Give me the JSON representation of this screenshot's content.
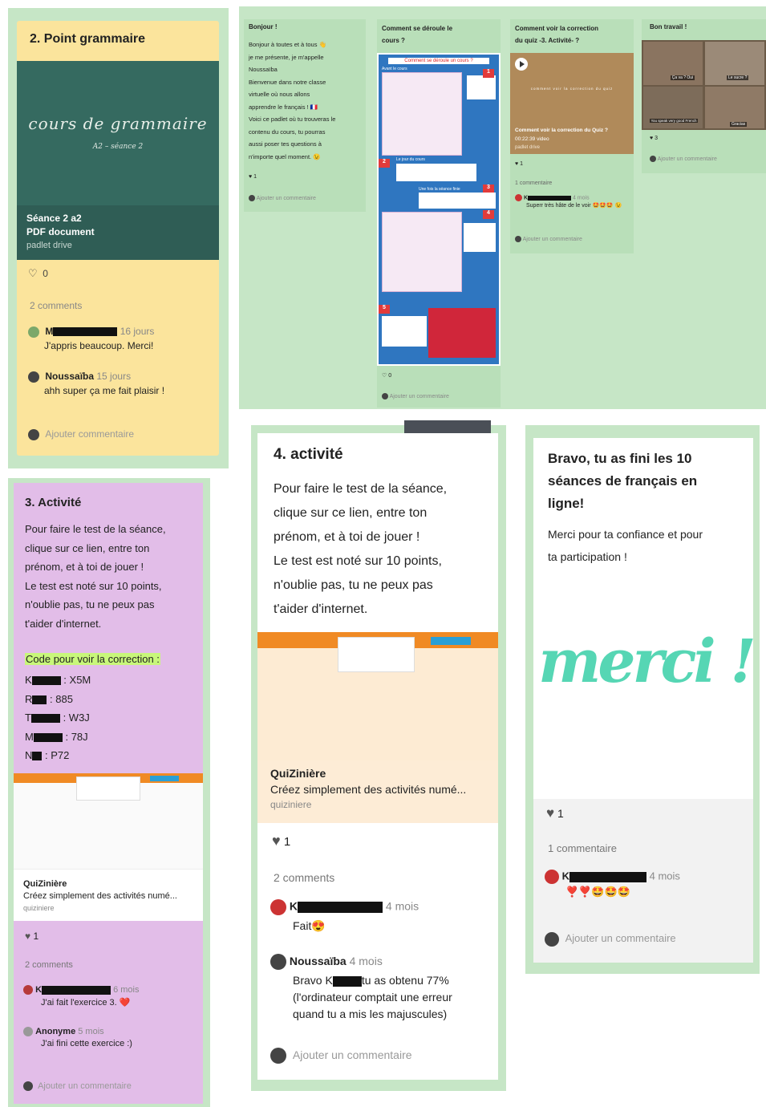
{
  "colors": {
    "board_bg": "#c6e6c6",
    "card_yellow": "#fbe49c",
    "card_purple": "#e2bde8",
    "chalkboard": "#2f5d55",
    "quiz_orange": "#f08a24",
    "white": "#ffffff"
  },
  "card_grammar": {
    "title": "2. Point grammaire",
    "chalk_title": "cours de grammaire",
    "chalk_sub": "A2 – séance 2",
    "attach_title": "Séance 2 a2",
    "attach_type": "PDF document",
    "attach_source": "padlet drive",
    "likes": "0",
    "comment_count": "2 comments",
    "comments": [
      {
        "name": "M",
        "time": "16 jours",
        "text": "J'appris beaucoup. Merci!"
      },
      {
        "name": "Noussaïba",
        "time": "15 jours",
        "text": "ahh super ça me fait plaisir !"
      }
    ],
    "add_comment": "Ajouter commentaire",
    "icons": [
      "heart-icon",
      "avatar-icon"
    ]
  },
  "strip": {
    "col1": {
      "title": "Bonjour !",
      "lines": [
        "Bonjour à toutes et à tous 👋",
        "je me présente, je m'appelle",
        "Noussaïba",
        "Bienvenue dans notre classe",
        "virtuelle où nous allons",
        "apprendre le français ! 🇫🇷",
        "Voici ce padlet où tu trouveras le",
        "contenu du cours, tu pourras",
        "aussi poser tes questions à",
        "n'importe quel moment. 😉"
      ],
      "likes": "1",
      "add_comment": "Ajouter un commentaire"
    },
    "col2": {
      "title_1": "Comment se déroule le",
      "title_2": "cours ?",
      "img_title": "Comment se déroule un cours ?",
      "img_sub1": "Avant le cours",
      "img_sub2": "Le jour du cours",
      "img_sub3": "Une fois la séance finie",
      "steps": [
        "1",
        "2",
        "3",
        "4",
        "5"
      ],
      "likes": "0",
      "add_comment": "Ajouter un commentaire"
    },
    "col3": {
      "title_1": "Comment voir la correction",
      "title_2": "du quiz -3. Activité- ?",
      "video_caption": "comment voir la correction du quiz",
      "video_title": "Comment voir la correction du Quiz ?",
      "video_meta": "00:22:39 video",
      "video_source": "padlet drive",
      "likes": "1",
      "comment_count": "1 commentaire",
      "comment_name": "K",
      "comment_time": "4 mois",
      "comment_text": "Superr très hâte de le voir 🤩🤩🤩 😉",
      "add_comment": "Ajouter un commentaire"
    },
    "col4": {
      "title": "Bon travail !",
      "meme_top": "Ça va ? Oui",
      "meme_right": "Le sucre ?",
      "meme_bottom": "You speak very good French",
      "meme_bottom_right": "Gracias",
      "likes": "3",
      "add_comment": "Ajouter un commentaire"
    }
  },
  "card_activity3": {
    "title": "3. Activité",
    "body": [
      "Pour faire le test de la séance,",
      "clique sur ce lien, entre ton",
      "prénom, et à toi de jouer !",
      "Le test est noté sur 10 points,",
      "n'oublie pas, tu ne peux pas",
      "t'aider d'internet."
    ],
    "code_label": "Code pour voir la correction :",
    "codes": [
      {
        "name": "K",
        "code": ": X5M"
      },
      {
        "name": "R",
        "code": ": 885"
      },
      {
        "name": "T",
        "code": ": W3J"
      },
      {
        "name": "M",
        "code": ": 78J"
      },
      {
        "name": "N",
        "code": ": P72"
      }
    ],
    "link_title": "QuiZinière",
    "link_desc": "Créez simplement des activités numé...",
    "link_source": "quiziniere",
    "likes": "1",
    "comment_count": "2 comments",
    "comments": [
      {
        "name": "K",
        "time": "6 mois",
        "text": "J'ai fait l'exercice 3. ❤️"
      },
      {
        "name": "Anonyme",
        "time": "5 mois",
        "text": "J'ai fini cette exercice :)"
      }
    ],
    "add_comment": "Ajouter un commentaire"
  },
  "card_activity4": {
    "title": "4. activité",
    "body": [
      "Pour faire le test de la séance,",
      "clique sur ce lien, entre ton",
      "prénom, et à toi de jouer !",
      "Le test est noté sur 10 points,",
      "n'oublie pas, tu ne peux pas",
      "t'aider d'internet."
    ],
    "link_title": "QuiZinière",
    "link_desc": "Créez simplement des activités numé...",
    "link_source": "quiziniere",
    "likes": "1",
    "comment_count": "2 comments",
    "comments": [
      {
        "name": "K",
        "time": "4 mois",
        "text": "Fait😍"
      },
      {
        "name": "Noussaïba",
        "time": "4 mois",
        "text_1": "Bravo K",
        "text_2": "tu as obtenu 77%",
        "text_3": "(l'ordinateur comptait une erreur",
        "text_4": "quand tu a mis les majuscules)"
      }
    ],
    "add_comment": "Ajouter un commentaire"
  },
  "card_bravo": {
    "title_1": "Bravo, tu as fini les 10",
    "title_2": "séances de français en",
    "title_3": "ligne!",
    "body_1": "Merci pour ta confiance et pour",
    "body_2": "ta participation !",
    "merci": "merci !",
    "likes": "1",
    "comment_count": "1 commentaire",
    "comment_name": "K",
    "comment_time": "4 mois",
    "comment_text": "❣️❣️🤩🤩🤩",
    "add_comment": "Ajouter un commentaire"
  }
}
